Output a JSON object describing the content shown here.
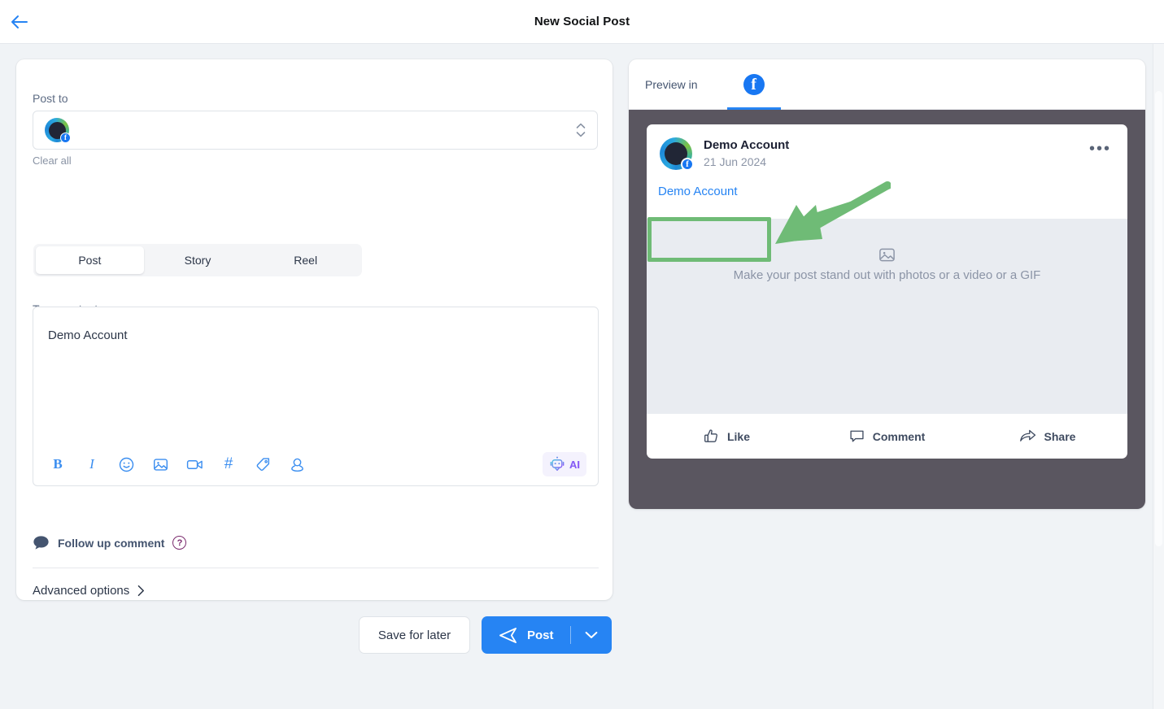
{
  "header": {
    "title": "New Social Post",
    "back_icon": "arrow-left-icon"
  },
  "compose": {
    "post_to_label": "Post to",
    "selected_account": {
      "name": "Demo Account",
      "network_badge": "facebook-badge"
    },
    "clear_all_label": "Clear all",
    "stepper_icon": "chevron-up-down-icon",
    "tabs": [
      {
        "label": "Post",
        "active": true
      },
      {
        "label": "Story",
        "active": false
      },
      {
        "label": "Reel",
        "active": false
      }
    ],
    "content_label": "Type content",
    "content_value": "Demo Account",
    "content_placeholder": "Type content",
    "toolbar": [
      {
        "icon": "bold-icon",
        "label": "B"
      },
      {
        "icon": "italic-icon",
        "label": "I"
      },
      {
        "icon": "emoji-icon",
        "label": ""
      },
      {
        "icon": "image-icon",
        "label": ""
      },
      {
        "icon": "video-icon",
        "label": ""
      },
      {
        "icon": "hashtag-icon",
        "label": "#"
      },
      {
        "icon": "tag-icon",
        "label": ""
      },
      {
        "icon": "location-icon",
        "label": ""
      }
    ],
    "ai_button": {
      "icon": "robot-icon",
      "label": "AI"
    },
    "follow_up": {
      "icon": "comment-bubble-icon",
      "label": "Follow up comment",
      "help_icon": "question-mark-icon",
      "help_label": "?"
    },
    "advanced_options": {
      "label": "Advanced options",
      "icon": "chevron-right-icon"
    }
  },
  "footer": {
    "save_label": "Save for later",
    "post_label": "Post",
    "post_icon": "send-icon",
    "post_caret_icon": "chevron-down-icon"
  },
  "preview": {
    "header_label": "Preview in",
    "active_network": "facebook",
    "network_tab_icon": "facebook-icon",
    "network_tab_glyph": "f",
    "card": {
      "author": "Demo Account",
      "date": "21 Jun 2024",
      "menu_icon": "more-horizontal-icon",
      "menu_glyph": "•••",
      "post_text": "Demo Account",
      "media_placeholder": "Make your post stand out with photos or a video or a GIF",
      "media_icon": "image-placeholder-icon",
      "actions": [
        {
          "label": "Like",
          "icon": "thumbs-up-icon"
        },
        {
          "label": "Comment",
          "icon": "comment-icon"
        },
        {
          "label": "Share",
          "icon": "share-icon"
        }
      ]
    }
  },
  "annotations": {
    "highlight_color": "#6fbb76",
    "arrow_icon": "annotation-arrow-icon",
    "box_icon": "annotation-highlight-box"
  },
  "colors": {
    "page_background": "#f0f3f6",
    "accent_blue": "#2684f3",
    "facebook_blue": "#1877f2",
    "preview_backdrop": "#5a5660",
    "annotation_green": "#6fbb76"
  }
}
